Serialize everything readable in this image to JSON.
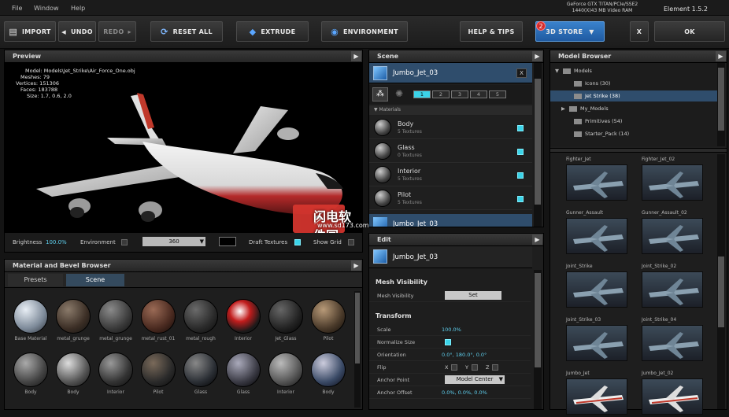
{
  "menu": [
    "File",
    "Window",
    "Help"
  ],
  "gpu_info": [
    "GeForce GTX TITAN/PCIe/SSE2",
    "1440(X)43 MB Video RAM"
  ],
  "version": "Element 1.5.2",
  "toolbar": {
    "import": "IMPORT",
    "undo": "UNDO",
    "redo": "REDO",
    "reset_all": "RESET ALL",
    "extrude": "EXTRUDE",
    "environment": "ENVIRONMENT",
    "help_tips": "HELP & TIPS",
    "store": "3D STORE",
    "store_badge": "2",
    "close": "X",
    "ok": "OK"
  },
  "preview": {
    "title": "Preview",
    "info": [
      "Model: Models\\Jet_Strike\\Air_Force_One.obj",
      "Meshes: 79",
      "Vertices: 151306",
      "Faces: 183788",
      "Size: 1.7, 0.6, 2.0"
    ],
    "brightness_label": "Brightness",
    "brightness_value": "100.0%",
    "environment_label": "Environment",
    "env_value": "360",
    "draft_label": "Draft Textures",
    "grid_label": "Show Grid"
  },
  "scene": {
    "title": "Scene",
    "object": "Jumbo_Jet_03",
    "close": "X",
    "tabs": [
      "1",
      "2",
      "3",
      "4",
      "5"
    ],
    "materials_label": "Materials",
    "materials": [
      {
        "name": "Body",
        "sub": "5 Textures"
      },
      {
        "name": "Glass",
        "sub": "0 Textures"
      },
      {
        "name": "Interior",
        "sub": "5 Textures"
      },
      {
        "name": "Pilot",
        "sub": "5 Textures"
      }
    ],
    "next_object": "Jumbo_Jet_03"
  },
  "edit": {
    "title": "Edit",
    "object": "Jumbo_Jet_03",
    "mesh_visibility_header": "Mesh Visibility",
    "mesh_visibility_label": "Mesh Visibility",
    "set_button": "Set",
    "transform_header": "Transform",
    "scale_label": "Scale",
    "scale_value": "100.0%",
    "normalize_label": "Normalize Size",
    "orientation_label": "Orientation",
    "orientation_value": "0.0°, 180.0°, 0.0°",
    "flip_label": "Flip",
    "flip_x": "X",
    "flip_y": "Y",
    "flip_z": "Z",
    "anchor_label": "Anchor Point",
    "anchor_value": "Model Center",
    "anchor_offset_label": "Anchor Offset",
    "anchor_offset_value": "0.0%, 0.0%, 0.0%"
  },
  "material_browser": {
    "title": "Material and Bevel Browser",
    "tabs": [
      "Presets",
      "Scene"
    ],
    "row1": [
      "Base Material",
      "metal_grunge",
      "metal_grunge",
      "metal_rust_01",
      "metal_rough",
      "Interior",
      "Jet_Glass",
      "Pilot"
    ],
    "row2": [
      "Body",
      "Body",
      "Interior",
      "Pilot",
      "Glass",
      "Glass",
      "Interior",
      "Body"
    ]
  },
  "model_browser": {
    "title": "Model Browser",
    "tree": [
      "Models",
      "Icons (30)",
      "Jet Strike (38)",
      "My_Models",
      "Primitives (54)",
      "Starter_Pack (14)"
    ],
    "thumbs": [
      "Fighter_Jet",
      "Fighter_Jet_02",
      "Gunner_Assault",
      "Gunner_Assault_02",
      "Joint_Strike",
      "Joint_Strike_02",
      "Joint_Strike_03",
      "Joint_Strike_04",
      "Jumbo_Jet",
      "Jumbo_Jet_02"
    ]
  },
  "watermark": {
    "cn": "闪电软件园",
    "url": "www.sd173.com"
  },
  "colors": {
    "accent": "#3bd3e8",
    "store_blue": "#2a6fb8",
    "badge": "#d42a2a"
  }
}
